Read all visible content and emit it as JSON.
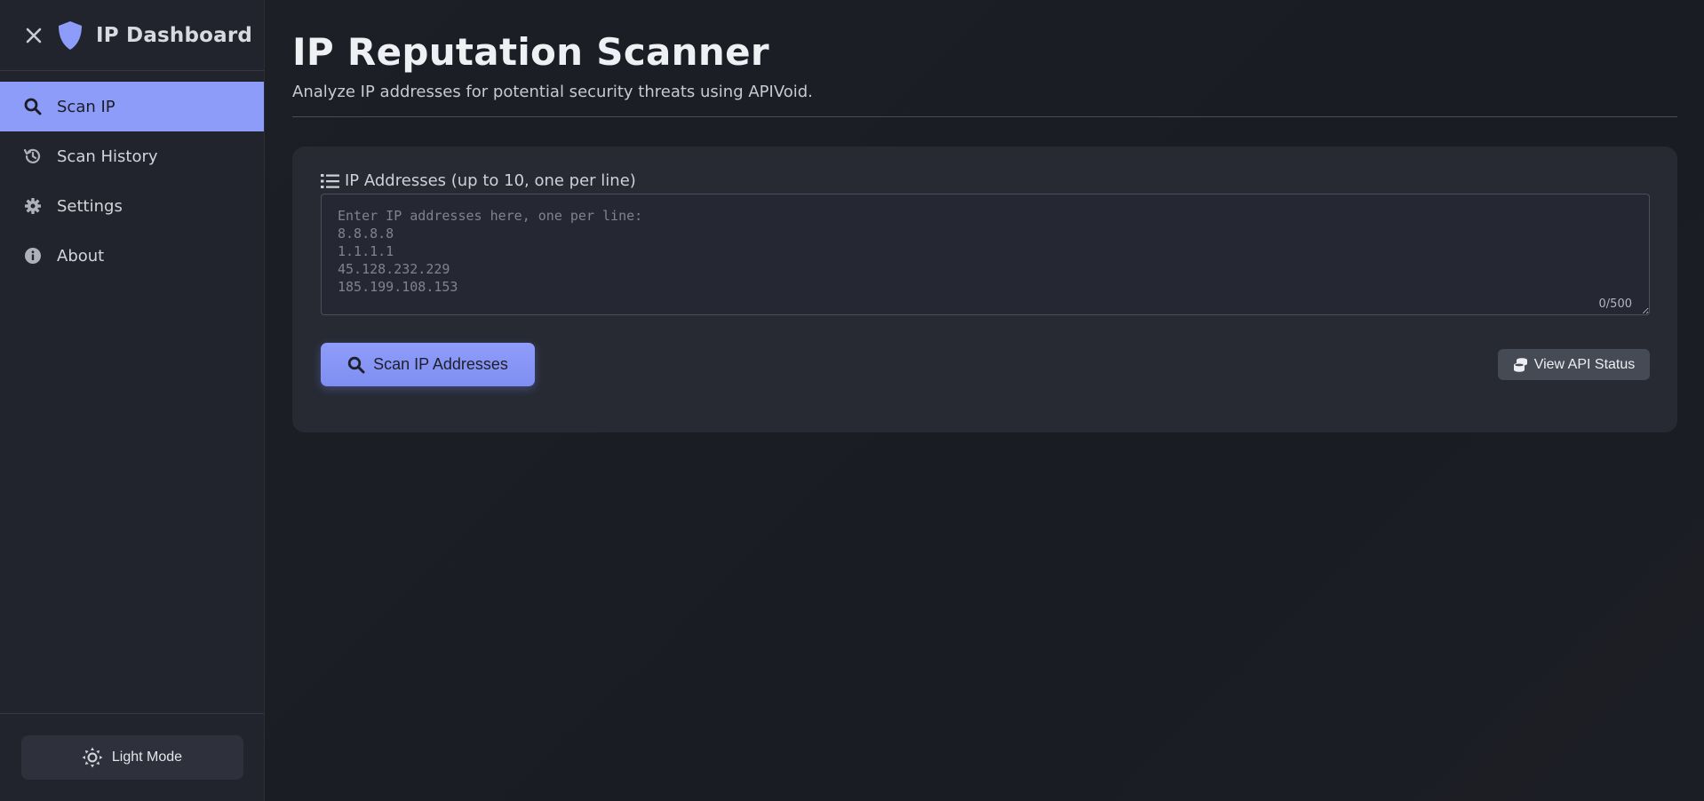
{
  "sidebar": {
    "brand": "IP Dashboard",
    "close_icon": "close-icon",
    "logo_icon": "shield-icon",
    "items": [
      {
        "label": "Scan IP",
        "icon": "search-icon",
        "active": true
      },
      {
        "label": "Scan History",
        "icon": "history-icon",
        "active": false
      },
      {
        "label": "Settings",
        "icon": "gear-icon",
        "active": false
      },
      {
        "label": "About",
        "icon": "info-icon",
        "active": false
      }
    ],
    "theme_toggle": {
      "label": "Light Mode",
      "icon": "sun-icon"
    }
  },
  "main": {
    "title": "IP Reputation Scanner",
    "subtitle": "Analyze IP addresses for potential security threats using APIVoid.",
    "form": {
      "label": "IP Addresses (up to 10, one per line)",
      "label_icon": "list-icon",
      "value": "",
      "placeholder": "Enter IP addresses here, one per line:\n8.8.8.8\n1.1.1.1\n45.128.232.229\n185.199.108.153",
      "char_count": "0/500",
      "scan_button": "Scan IP Addresses",
      "api_button": "View API Status"
    }
  },
  "colors": {
    "accent": "#8c9cf8",
    "background": "#1b1d25",
    "sidebar": "#22242d",
    "card": "#272a33"
  }
}
